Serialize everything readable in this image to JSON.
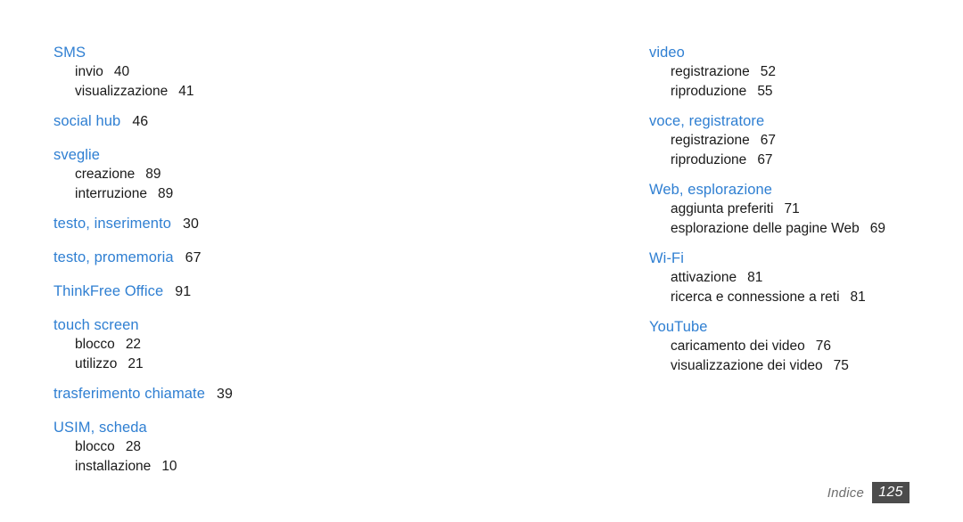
{
  "document": {
    "footer_label": "Indice",
    "page_number": "125",
    "accent_color": "#2f7fd2",
    "text_color": "#1a1a1a",
    "badge_color": "#4c4c4c",
    "footer_label_color": "#6e6e6e",
    "background_color": "#ffffff"
  },
  "columns": [
    {
      "id": "left",
      "groups": [
        {
          "heading": "SMS",
          "heading_page": "",
          "subentries": [
            {
              "label": "invio",
              "page": "40"
            },
            {
              "label": "visualizzazione",
              "page": "41"
            }
          ]
        },
        {
          "heading": "social hub",
          "heading_page": "46",
          "subentries": []
        },
        {
          "heading": "sveglie",
          "heading_page": "",
          "subentries": [
            {
              "label": "creazione",
              "page": "89"
            },
            {
              "label": "interruzione",
              "page": "89"
            }
          ]
        },
        {
          "heading": "testo, inserimento",
          "heading_page": "30",
          "subentries": []
        },
        {
          "heading": "testo, promemoria",
          "heading_page": "67",
          "subentries": []
        },
        {
          "heading": "ThinkFree Office",
          "heading_page": "91",
          "subentries": []
        },
        {
          "heading": "touch screen",
          "heading_page": "",
          "subentries": [
            {
              "label": "blocco",
              "page": "22"
            },
            {
              "label": "utilizzo",
              "page": "21"
            }
          ]
        },
        {
          "heading": "trasferimento chiamate",
          "heading_page": "39",
          "subentries": []
        },
        {
          "heading": "USIM, scheda",
          "heading_page": "",
          "subentries": [
            {
              "label": "blocco",
              "page": "28"
            },
            {
              "label": "installazione",
              "page": "10"
            }
          ]
        }
      ]
    },
    {
      "id": "right",
      "groups": [
        {
          "heading": "video",
          "heading_page": "",
          "subentries": [
            {
              "label": "registrazione",
              "page": "52"
            },
            {
              "label": "riproduzione",
              "page": "55"
            }
          ]
        },
        {
          "heading": "voce, registratore",
          "heading_page": "",
          "subentries": [
            {
              "label": "registrazione",
              "page": "67"
            },
            {
              "label": "riproduzione",
              "page": "67"
            }
          ]
        },
        {
          "heading": "Web, esplorazione",
          "heading_page": "",
          "subentries": [
            {
              "label": "aggiunta preferiti",
              "page": "71"
            },
            {
              "label": "esplorazione delle pagine Web",
              "page": "69"
            }
          ]
        },
        {
          "heading": "Wi-Fi",
          "heading_page": "",
          "subentries": [
            {
              "label": "attivazione",
              "page": "81"
            },
            {
              "label": "ricerca e connessione a reti",
              "page": "81"
            }
          ]
        },
        {
          "heading": "YouTube",
          "heading_page": "",
          "subentries": [
            {
              "label": "caricamento dei video",
              "page": "76"
            },
            {
              "label": "visualizzazione dei video",
              "page": "75"
            }
          ]
        }
      ]
    }
  ]
}
